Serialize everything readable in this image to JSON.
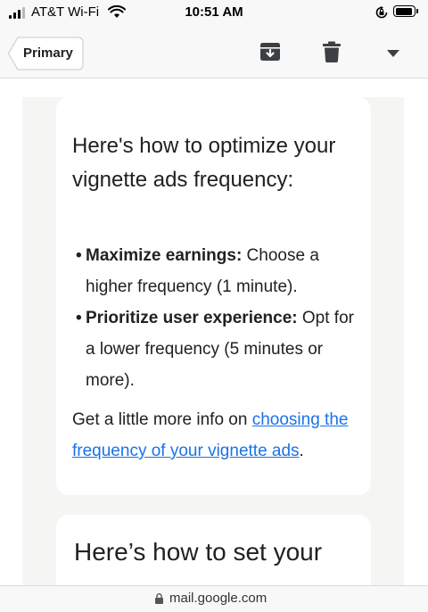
{
  "status_bar": {
    "carrier": "AT&T Wi-Fi",
    "time": "10:51 AM"
  },
  "header": {
    "back_label": "Primary",
    "icons": [
      "archive-icon",
      "trash-icon",
      "dropdown-arrow-icon"
    ]
  },
  "email": {
    "heading": "Here's how to optimize your vignette ads frequency:",
    "bullets": [
      {
        "bold": "Maximize earnings:",
        "text": " Choose a higher frequency (1 minute)."
      },
      {
        "bold": "Prioritize user experience:",
        "text": " Opt for a lower frequency (5 minutes or more)."
      }
    ],
    "info_prefix": "Get a little more info on ",
    "info_link": "choosing the frequency of your vignette ads",
    "info_suffix": ".",
    "next_heading": "Here’s how to set your"
  },
  "url_bar": {
    "url": "mail.google.com"
  }
}
